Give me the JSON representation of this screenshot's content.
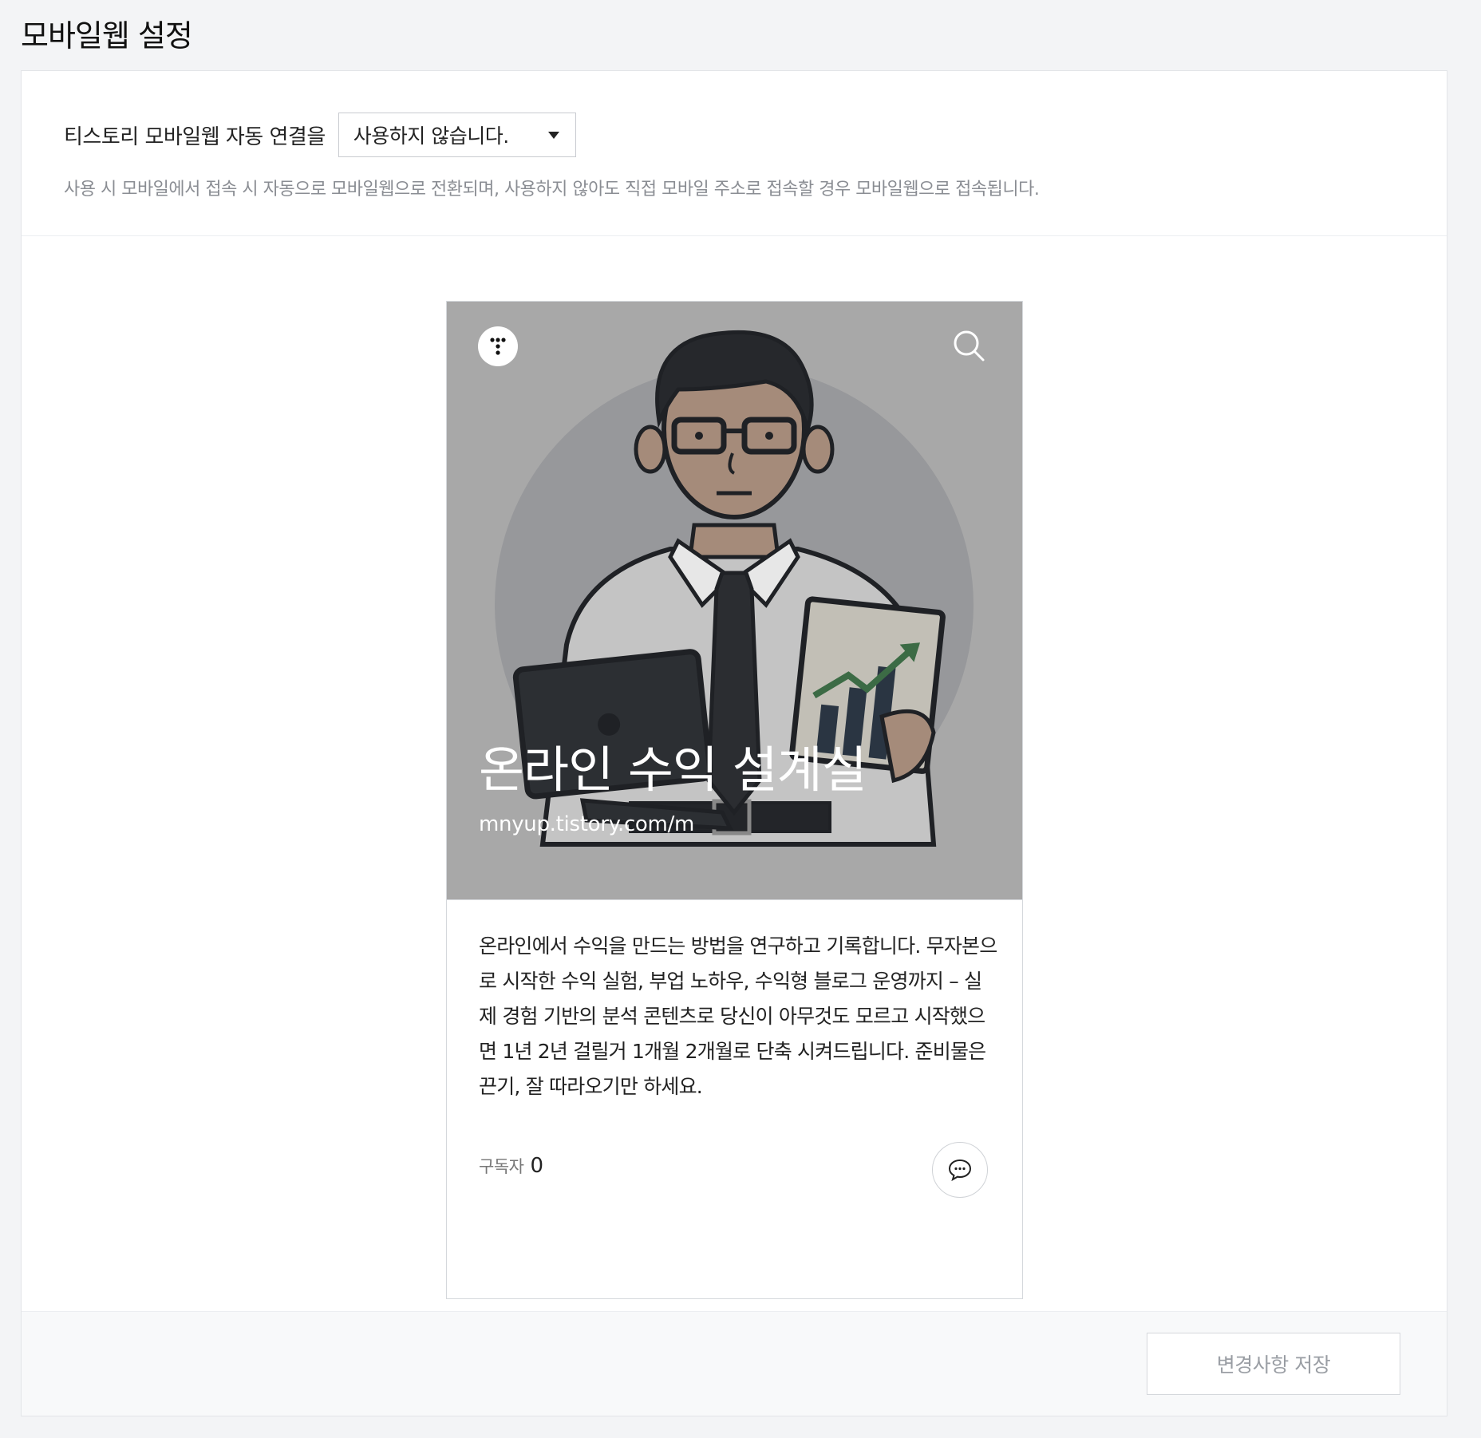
{
  "page": {
    "title": "모바일웹 설정"
  },
  "setting": {
    "label": "티스토리 모바일웹 자동 연결을",
    "select_value": "사용하지 않습니다.",
    "help": "사용 시 모바일에서 접속 시 자동으로 모바일웹으로 전환되며, 사용하지 않아도 직접 모바일 주소로 접속할 경우 모바일웹으로 접속됩니다."
  },
  "preview": {
    "blog_title": "온라인 수익 설계실",
    "blog_url": "mnyup.tistory.com/m",
    "description": "온라인에서 수익을 만드는 방법을 연구하고 기록합니다. 무자본으로 시작한 수익 실험, 부업 노하우, 수익형 블로그 운영까지 – 실제 경험 기반의 분석 콘텐츠로 당신이 아무것도 모르고 시작했으면 1년 2년 걸릴거 1개월 2개월로 단축 시켜드립니다. 준비물은 끈기, 잘 따라오기만 하세요.",
    "subscriber_label": "구독자",
    "subscriber_count": "0",
    "icons": {
      "logo": "tistory-logo-icon",
      "search": "search-icon",
      "comment": "chat-bubble-icon"
    }
  },
  "footer": {
    "save_label": "변경사항 저장"
  },
  "colors": {
    "background": "#f3f4f6",
    "cover": "#a8a8a8",
    "chart_green": "#3c6b45"
  }
}
